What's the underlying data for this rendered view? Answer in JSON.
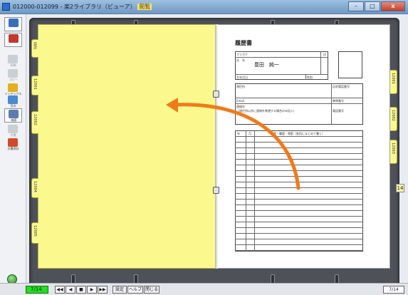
{
  "window": {
    "title": "012000-012099 - 楽2ライブラリ（ビューア）",
    "title_tag": "閲覧",
    "min": "–",
    "max": "□",
    "close": "x"
  },
  "toolbar": {
    "items": [
      {
        "label": "",
        "icon": "exit-icon",
        "color": "#3a6fb8",
        "state": "boxed"
      },
      {
        "label": "",
        "icon": "print-icon",
        "color": "#c0392b",
        "state": "boxed"
      },
      {
        "label": "印刷",
        "icon": "print-setup-icon",
        "color": "#9aa4b0",
        "state": "dim"
      },
      {
        "label": "コピー",
        "icon": "copy-icon",
        "color": "#9aa4b0",
        "state": "dim"
      },
      {
        "label": "インデックス",
        "icon": "index-icon",
        "color": "#e0b020",
        "state": "normal"
      },
      {
        "label": "目次",
        "icon": "toc-icon",
        "color": "#4a8acd",
        "state": "normal"
      },
      {
        "label": "検索",
        "icon": "search-icon",
        "color": "#5b7db0",
        "state": "boxed"
      },
      {
        "label": "付箋",
        "icon": "sticky-note-icon",
        "color": "#9aa4b0",
        "state": "dim"
      },
      {
        "label": "文書保存",
        "icon": "save-document-icon",
        "color": "#d24a2a",
        "state": "normal"
      }
    ]
  },
  "left_tabs": [
    "目次",
    "12001",
    "12002",
    "12004",
    "12005"
  ],
  "right_tabs": [
    "12001",
    "12002",
    "12003"
  ],
  "current_page_tab": "14",
  "resume": {
    "title": "履歴書",
    "furigana": "フリガナ",
    "name_label": "氏　名",
    "name_value": "豊田　純一",
    "seal": "印",
    "birth": "生年月日",
    "gender": "性別",
    "address": "現住所",
    "home_phone": "自宅電話番号",
    "email": "Email",
    "mobile": "携帯番号",
    "contact": "連絡先",
    "contact_note": "（現住所以外に連絡を希望する場合のみ記入）",
    "contact_phone": "電話番号",
    "history_year": "年",
    "history_month": "月",
    "history_header": "学歴・職歴・賞罰（各別にまとめて書く）"
  },
  "status": {
    "page": "7/14",
    "first": "◀◀",
    "prev": "◀",
    "stop": "■",
    "next": "▶",
    "last": "▶▶",
    "settings": "設定",
    "help": "ヘルプ",
    "close": "閉じる",
    "page_count": "7/14"
  },
  "colors": {
    "accent_arrow": "#f07a1a",
    "page_yellow": "#fbf98e",
    "page_badge": "#22dd22"
  }
}
